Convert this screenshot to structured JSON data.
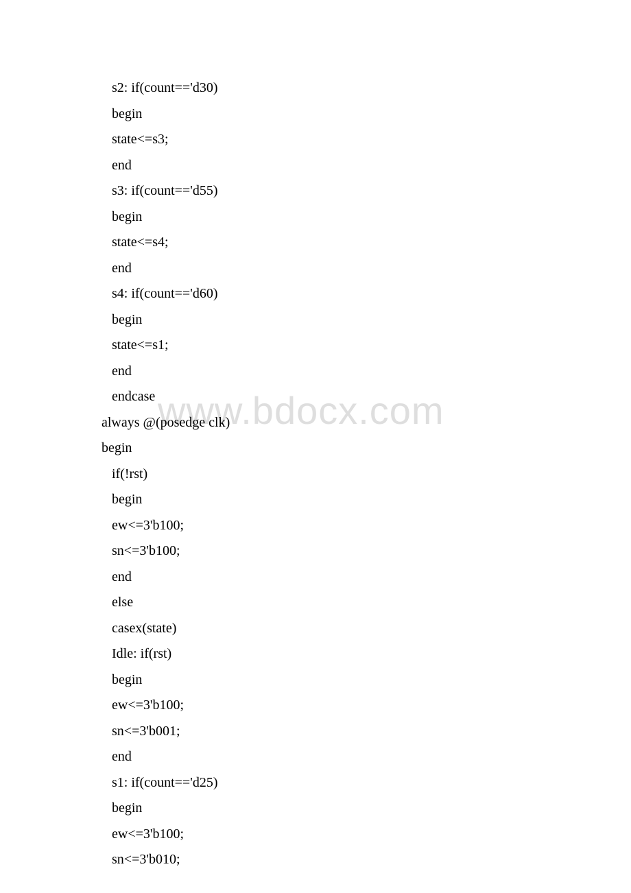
{
  "watermark": "www.bdocx.com",
  "lines": [
    {
      "indent": 1,
      "text": " s2: if(count=='d30)"
    },
    {
      "indent": 1,
      "text": " begin"
    },
    {
      "indent": 1,
      "text": " state<=s3;"
    },
    {
      "indent": 1,
      "text": " end"
    },
    {
      "indent": 1,
      "text": " s3: if(count=='d55)"
    },
    {
      "indent": 1,
      "text": " begin"
    },
    {
      "indent": 1,
      "text": " state<=s4;"
    },
    {
      "indent": 1,
      "text": " end"
    },
    {
      "indent": 1,
      "text": " s4: if(count=='d60)"
    },
    {
      "indent": 1,
      "text": " begin"
    },
    {
      "indent": 1,
      "text": " state<=s1;"
    },
    {
      "indent": 1,
      "text": " end"
    },
    {
      "indent": 1,
      "text": " endcase"
    },
    {
      "indent": 2,
      "text": "always @(posedge clk)"
    },
    {
      "indent": 2,
      "text": "begin"
    },
    {
      "indent": 1,
      "text": " if(!rst)"
    },
    {
      "indent": 1,
      "text": " begin"
    },
    {
      "indent": 1,
      "text": " ew<=3'b100;"
    },
    {
      "indent": 1,
      "text": " sn<=3'b100;"
    },
    {
      "indent": 1,
      "text": " end"
    },
    {
      "indent": 1,
      "text": " else"
    },
    {
      "indent": 1,
      "text": " casex(state)"
    },
    {
      "indent": 1,
      "text": " Idle: if(rst)"
    },
    {
      "indent": 1,
      "text": " begin"
    },
    {
      "indent": 1,
      "text": " ew<=3'b100;"
    },
    {
      "indent": 1,
      "text": " sn<=3'b001;"
    },
    {
      "indent": 1,
      "text": " end"
    },
    {
      "indent": 1,
      "text": " s1: if(count=='d25)"
    },
    {
      "indent": 1,
      "text": " begin"
    },
    {
      "indent": 1,
      "text": " ew<=3'b100;"
    },
    {
      "indent": 1,
      "text": " sn<=3'b010;"
    }
  ]
}
